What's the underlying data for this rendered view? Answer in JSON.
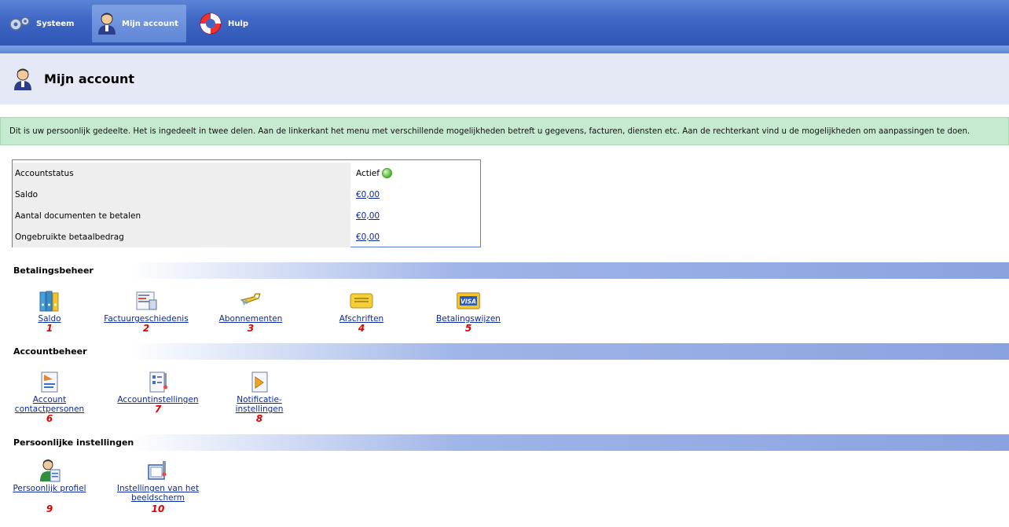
{
  "tabs": [
    {
      "label": "Systeem",
      "icon": "gears-icon"
    },
    {
      "label": "Mijn account",
      "icon": "user-icon"
    },
    {
      "label": "Hulp",
      "icon": "lifebuoy-icon"
    }
  ],
  "page": {
    "title": "Mijn account"
  },
  "info": "Dit is uw persoonlijk gedeelte. Het is ingedeelt in twee delen. Aan de linkerkant het menu met verschillende mogelijkheden betreft u gegevens, facturen, diensten etc. Aan de rechterkant vind u de mogelijkheden om aanpassingen te doen.",
  "status": {
    "rows": [
      {
        "label": "Accountstatus",
        "value": "Actief"
      },
      {
        "label": "Saldo",
        "value": "€0,00"
      },
      {
        "label": "Aantal documenten te betalen",
        "value": "€0,00"
      },
      {
        "label": "Ongebruikte betaalbedrag",
        "value": "€0,00"
      }
    ]
  },
  "sections": {
    "betaling": {
      "title": "Betalingsbeheer",
      "items": [
        {
          "label": "Saldo",
          "num": "1",
          "icon": "binders-icon"
        },
        {
          "label": "Factuurgeschiedenis",
          "num": "2",
          "icon": "invoice-icon"
        },
        {
          "label": "Abonnementen",
          "num": "3",
          "icon": "key-icon"
        },
        {
          "label": "Afschriften",
          "num": "4",
          "icon": "card-icon"
        },
        {
          "label": "Betalingswijzen",
          "num": "5",
          "icon": "visa-icon"
        }
      ]
    },
    "account": {
      "title": "Accountbeheer",
      "items": [
        {
          "label1": "Account",
          "label2": "contactpersonen",
          "num": "6",
          "icon": "contact-doc-icon"
        },
        {
          "label1": "Accountinstellingen",
          "label2": "",
          "num": "7",
          "icon": "settings-doc-icon"
        },
        {
          "label1": "Notificatie-",
          "label2": "instellingen",
          "num": "8",
          "icon": "notification-doc-icon"
        }
      ]
    },
    "persoonlijk": {
      "title": "Persoonlijke instellingen",
      "items": [
        {
          "label1": "Persoonlijk profiel",
          "label2": "",
          "num": "9",
          "icon": "profile-icon"
        },
        {
          "label1": "Instellingen van het",
          "label2": "beeldscherm",
          "num": "10",
          "icon": "screen-settings-icon"
        }
      ]
    }
  }
}
